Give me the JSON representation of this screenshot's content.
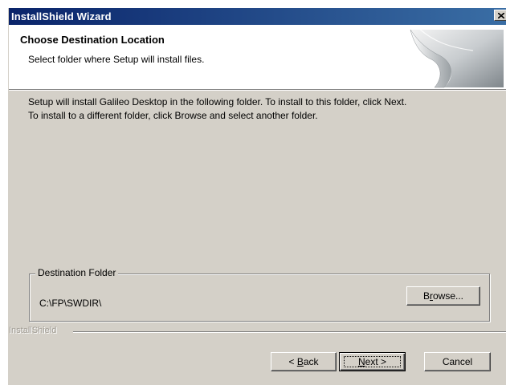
{
  "window": {
    "title": "InstallShield Wizard"
  },
  "header": {
    "title": "Choose Destination Location",
    "subtitle": "Select folder where Setup will install files."
  },
  "body": {
    "line1": "Setup will install Galileo Desktop in the following folder.  To install to this folder, click Next.",
    "line2": "To install to a different folder, click Browse and select another folder."
  },
  "destination": {
    "group_label": "Destination Folder",
    "path": "C:\\FP\\SWDIR\\",
    "browse_pre": "B",
    "browse_mnemonic": "r",
    "browse_post": "owse..."
  },
  "footer": {
    "brand": "InstallShield"
  },
  "buttons": {
    "back_pre": "< ",
    "back_mnemonic": "B",
    "back_post": "ack",
    "next_mnemonic": "N",
    "next_post": "ext >",
    "cancel": "Cancel"
  },
  "colors": {
    "titlebar": "#0a246a",
    "dialog_face": "#d4d0c8",
    "header_bg": "#ffffff"
  },
  "icons": {
    "close": "close-icon",
    "header_graphic": "page-curl-icon"
  }
}
